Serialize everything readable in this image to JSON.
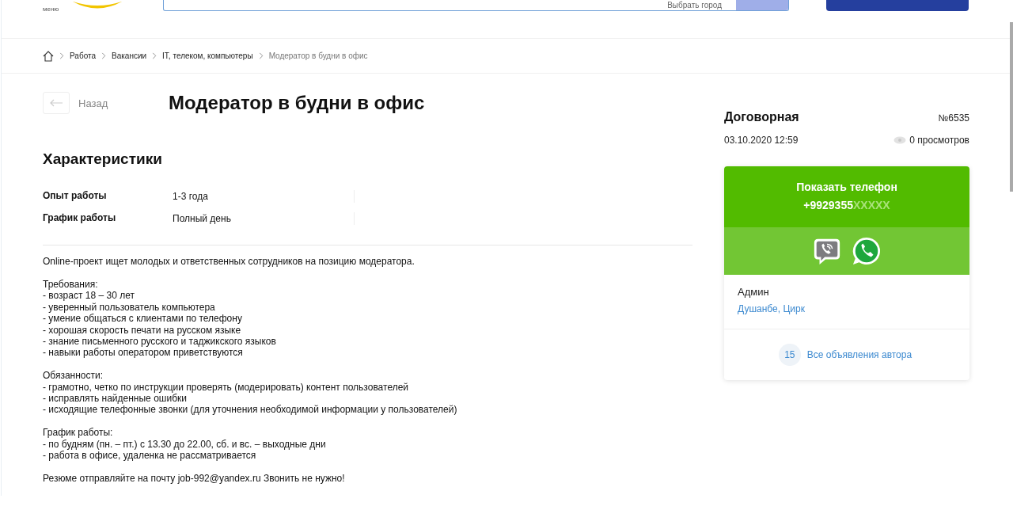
{
  "header": {
    "menu_label": "меню",
    "city_select": "Выбрать город"
  },
  "breadcrumbs": [
    {
      "label": "Работа",
      "current": false
    },
    {
      "label": "Вакансии",
      "current": false
    },
    {
      "label": "IT, телеком, компьютеры",
      "current": false
    },
    {
      "label": "Модератор в будни в офис",
      "current": true
    }
  ],
  "back_button": {
    "label": "Назад"
  },
  "title": "Модератор в будни в офис",
  "characteristics": {
    "heading": "Характеристики",
    "rows": [
      {
        "label": "Опыт работы",
        "value": "1-3 года"
      },
      {
        "label": "График работы",
        "value": "Полный день"
      }
    ]
  },
  "description": [
    "Online-проект ищет молодых и ответственных сотрудников на позицию модератора.",
    "Требования:\n- возраст 18 – 30 лет\n- уверенный пользователь компьютера\n- умение общаться с клиентами по телефону\n- хорошая скорость печати на русском языке\n- знание письменного русского и таджикского языков\n- навыки работы оператором приветствуются",
    "Обязанности:\n- грамотно, четко по инструкции проверять (модерировать) контент пользователей\n- исправлять найденные ошибки\n- исходящие телефонные звонки (для уточнения необходимой информации у пользователей)",
    "График работы:\n- по будням (пн. – пт.) с 13.30 до 22.00, сб. и вс. – выходные дни\n- работа в офисе, удаленка не рассматривается",
    "Резюме отправляйте на почту job-992@yandex.ru Звонить не нужно!"
  ],
  "sidebar": {
    "salary": "Договорная",
    "ad_number": "№6535",
    "date": "03.10.2020 12:59",
    "views": "0 просмотров",
    "phone": {
      "button_label": "Показать телефон",
      "number_visible": "+9929355",
      "number_hidden": "XXXXX"
    },
    "author": {
      "name": "Админ",
      "location": "Душанбе, Цирк",
      "ads_count": "15",
      "all_ads_link": "Все объявления автора"
    }
  }
}
